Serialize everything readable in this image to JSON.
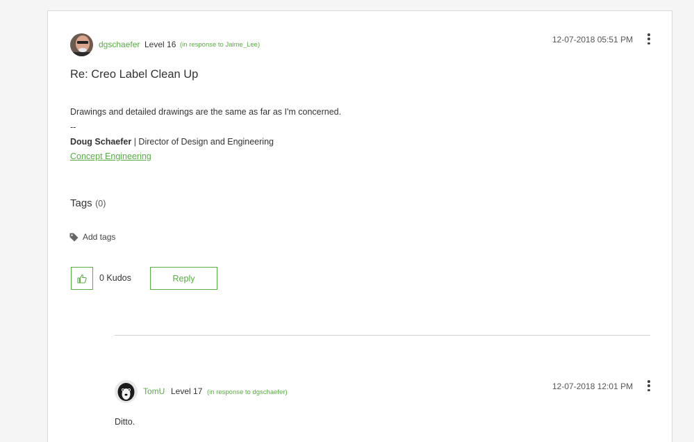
{
  "post1": {
    "author": "dgschaefer",
    "level": "Level 16",
    "in_response": "(in response to Jaime_Lee)",
    "timestamp": "12-07-2018 05:51 PM",
    "subject": "Re: Creo Label Clean Up",
    "body_line1": "Drawings and detailed drawings are the same as far as I'm concerned.",
    "signature_dashes": "--",
    "signature_name": "Doug Schaefer",
    "signature_title": " | Director of Design and Engineering",
    "signature_link": "Concept Engineering"
  },
  "tags": {
    "title": "Tags",
    "count": "(0)",
    "add_label": "Add tags"
  },
  "actions": {
    "kudos_count": "0 Kudos",
    "reply_label": "Reply"
  },
  "post2": {
    "author": "TomU",
    "level": "Level 17",
    "in_response": "(in response to dgschaefer)",
    "timestamp": "12-07-2018 12:01 PM",
    "body_line1": "Ditto."
  },
  "colors": {
    "accent": "#5aac44",
    "background": "#f5f5f5",
    "panel": "#ffffff"
  },
  "icons": [
    "avatar",
    "more-options-icon",
    "tag-icon",
    "thumbs-up-icon"
  ]
}
